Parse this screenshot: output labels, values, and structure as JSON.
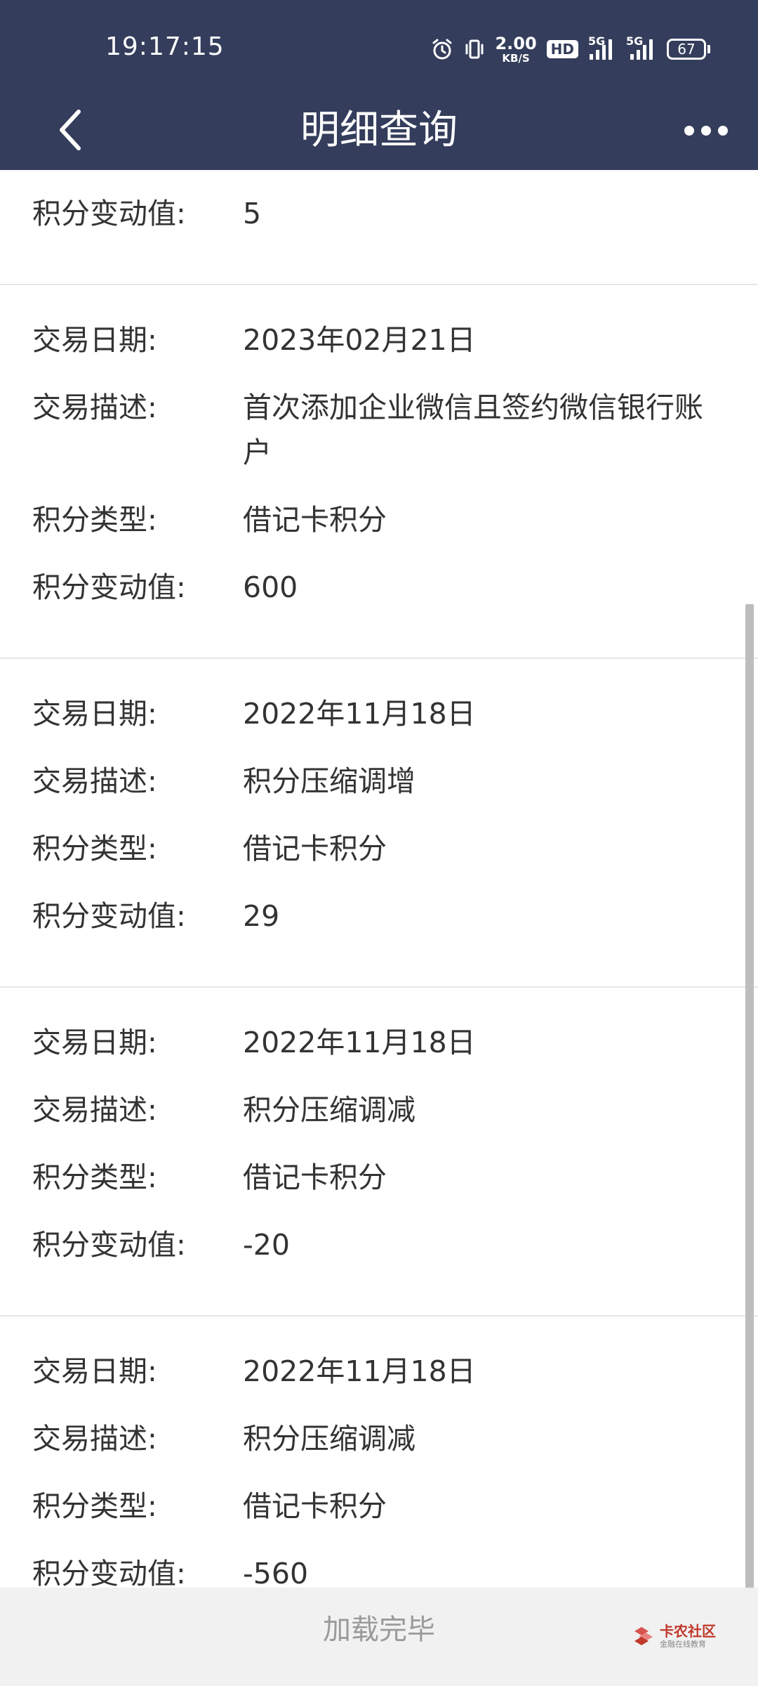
{
  "status_bar": {
    "time": "19:17:15",
    "net_speed_value": "2.00",
    "net_speed_unit": "KB/S",
    "hd_label": "HD",
    "sim1_label": "5G",
    "sim2_label": "5G",
    "battery_level": "67"
  },
  "nav": {
    "title": "明细查询"
  },
  "records": [
    {
      "change_label": "积分变动值:",
      "change_value": "5"
    },
    {
      "date_label": "交易日期:",
      "date_value": "2023年02月21日",
      "desc_label": "交易描述:",
      "desc_value": "首次添加企业微信且签约微信银行账户",
      "type_label": "积分类型:",
      "type_value": "借记卡积分",
      "change_label": "积分变动值:",
      "change_value": "600"
    },
    {
      "date_label": "交易日期:",
      "date_value": "2022年11月18日",
      "desc_label": "交易描述:",
      "desc_value": "积分压缩调增",
      "type_label": "积分类型:",
      "type_value": "借记卡积分",
      "change_label": "积分变动值:",
      "change_value": "29"
    },
    {
      "date_label": "交易日期:",
      "date_value": "2022年11月18日",
      "desc_label": "交易描述:",
      "desc_value": "积分压缩调减",
      "type_label": "积分类型:",
      "type_value": "借记卡积分",
      "change_label": "积分变动值:",
      "change_value": "-20"
    },
    {
      "date_label": "交易日期:",
      "date_value": "2022年11月18日",
      "desc_label": "交易描述:",
      "desc_value": "积分压缩调减",
      "type_label": "积分类型:",
      "type_value": "借记卡积分",
      "change_label": "积分变动值:",
      "change_value": "-560"
    }
  ],
  "footer": {
    "load_status": "加载完毕",
    "watermark_name": "卡农社区",
    "watermark_sub": "金融在线教育"
  },
  "colors": {
    "header_bg": "#343d5b",
    "text": "#333333",
    "footer_bg": "#f1f1f1"
  }
}
